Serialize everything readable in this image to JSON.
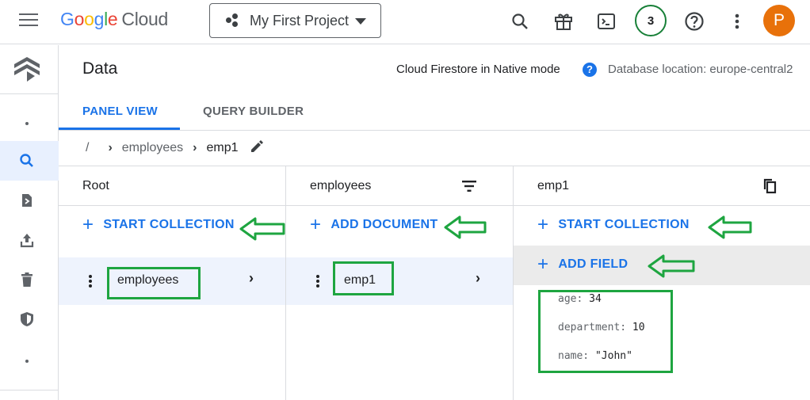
{
  "topbar": {
    "product_google": "Google",
    "product_cloud": "Cloud",
    "project_name": "My First Project",
    "notification_count": "3",
    "avatar_letter": "P"
  },
  "brand_colors": {
    "g_blue": "#4285F4",
    "g_red": "#EA4335",
    "g_yellow": "#FBBC05",
    "g_green": "#34A853"
  },
  "icons": [
    "menu-icon",
    "search-icon",
    "gift-icon",
    "terminal-icon",
    "help-circle-icon",
    "more-vert-icon",
    "firestore-logo-icon",
    "search-icon",
    "import-icon",
    "export-icon",
    "delete-icon",
    "security-icon",
    "edit-icon",
    "filter-icon",
    "copy-icon"
  ],
  "page": {
    "title": "Data",
    "mode": "Cloud Firestore in Native mode",
    "help": "?",
    "location": "Database location: europe-central2"
  },
  "tabs": [
    {
      "label": "PANEL VIEW",
      "active": true
    },
    {
      "label": "QUERY BUILDER",
      "active": false
    }
  ],
  "breadcrumb": {
    "root": "/",
    "collection": "employees",
    "document": "emp1"
  },
  "columns": {
    "root": {
      "title": "Root",
      "action": "START COLLECTION",
      "item": "employees"
    },
    "employees": {
      "title": "employees",
      "action": "ADD DOCUMENT",
      "item": "emp1"
    },
    "emp1": {
      "title": "emp1",
      "action_collection": "START COLLECTION",
      "action_field": "ADD FIELD",
      "fields": [
        {
          "key": "age:",
          "value": "34"
        },
        {
          "key": "department:",
          "value": "10"
        },
        {
          "key": "name:",
          "value": "\"John\""
        }
      ]
    }
  },
  "annotation_color": "#1ea540",
  "accent": "#1a73e8"
}
